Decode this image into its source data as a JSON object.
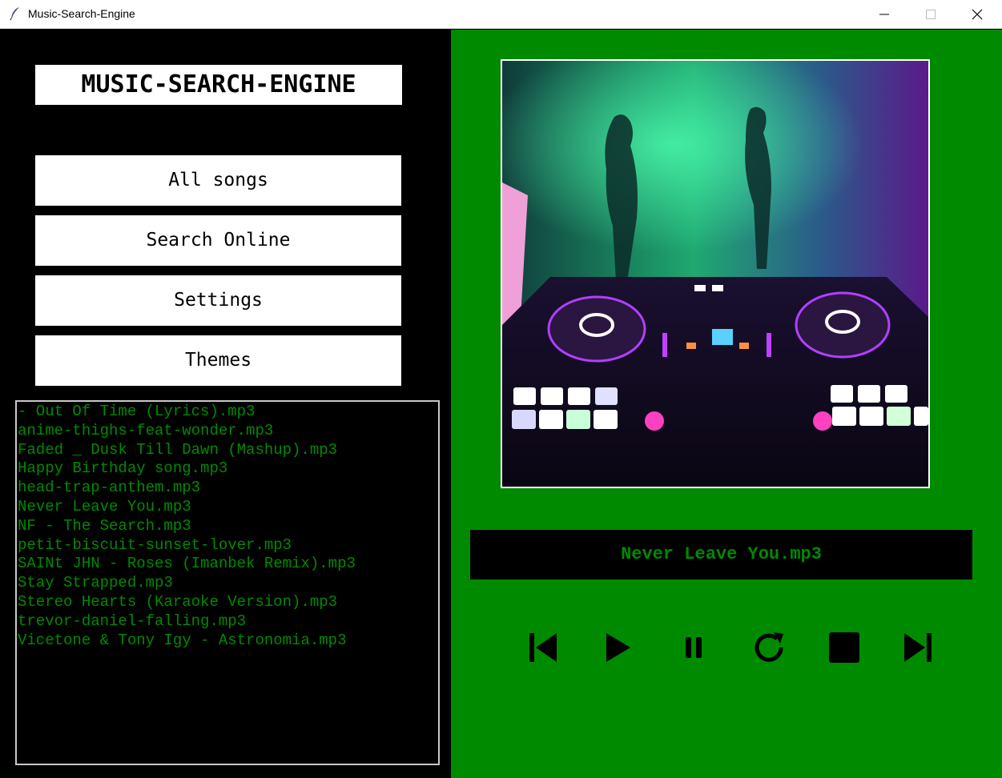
{
  "window": {
    "title": "Music-Search-Engine",
    "app_icon": "feather-icon",
    "controls": [
      "minimize-icon",
      "maximize-icon",
      "close-icon"
    ]
  },
  "sidebar": {
    "app_title": "MUSIC-SEARCH-ENGINE",
    "buttons": [
      {
        "label": "All songs"
      },
      {
        "label": "Search Online"
      },
      {
        "label": "Settings"
      },
      {
        "label": "Themes"
      }
    ]
  },
  "song_list": {
    "items": [
      "- Out Of Time (Lyrics).mp3",
      "anime-thighs-feat-wonder.mp3",
      "Faded _ Dusk Till Dawn (Mashup).mp3",
      "Happy Birthday song.mp3",
      "head-trap-anthem.mp3",
      "Never Leave You.mp3",
      "NF - The Search.mp3",
      "petit-biscuit-sunset-lover.mp3",
      "SAINt JHN - Roses (Imanbek Remix).mp3",
      "Stay Strapped.mp3",
      "Stereo Hearts (Karaoke Version).mp3",
      "trevor-daniel-falling.mp3",
      "Vicetone & Tony Igy - Astronomia.mp3"
    ]
  },
  "player": {
    "now_playing": "Never Leave You.mp3",
    "controls": [
      "previous-icon",
      "play-icon",
      "pause-icon",
      "repeat-icon",
      "stop-icon",
      "next-icon"
    ]
  },
  "colors": {
    "accent_green": "#008a00",
    "panel_black": "#000000",
    "button_white": "#ffffff"
  }
}
